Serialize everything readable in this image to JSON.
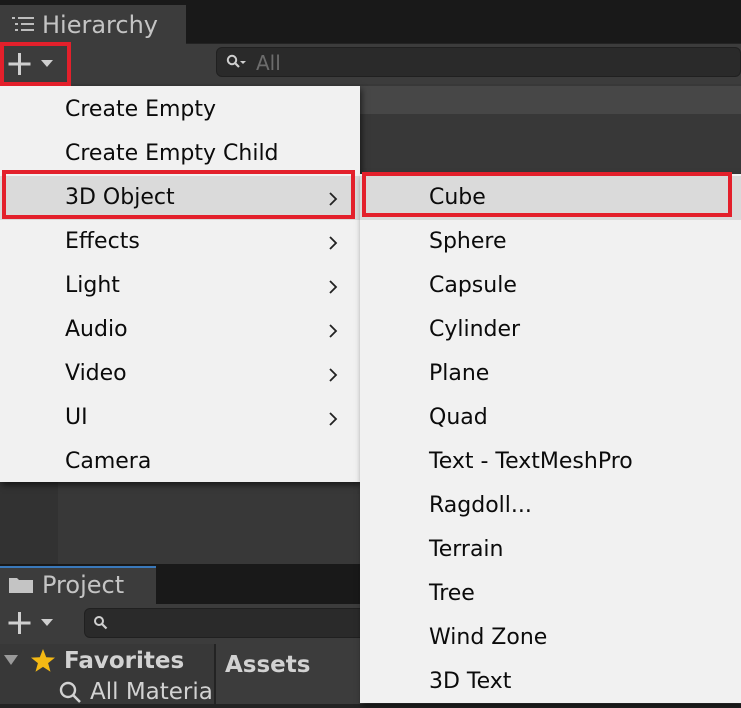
{
  "hierarchy": {
    "tab_title": "Hierarchy",
    "search_placeholder": "All"
  },
  "create_menu": {
    "items": [
      {
        "label": "Create Empty",
        "has_submenu": false
      },
      {
        "label": "Create Empty Child",
        "has_submenu": false
      },
      {
        "label": "3D Object",
        "has_submenu": true
      },
      {
        "label": "Effects",
        "has_submenu": true
      },
      {
        "label": "Light",
        "has_submenu": true
      },
      {
        "label": "Audio",
        "has_submenu": true
      },
      {
        "label": "Video",
        "has_submenu": true
      },
      {
        "label": "UI",
        "has_submenu": true
      },
      {
        "label": "Camera",
        "has_submenu": false
      }
    ]
  },
  "submenu_3d_object": {
    "items": [
      {
        "label": "Cube"
      },
      {
        "label": "Sphere"
      },
      {
        "label": "Capsule"
      },
      {
        "label": "Cylinder"
      },
      {
        "label": "Plane"
      },
      {
        "label": "Quad"
      },
      {
        "label": "Text - TextMeshPro"
      },
      {
        "label": "Ragdoll..."
      },
      {
        "label": "Terrain"
      },
      {
        "label": "Tree"
      },
      {
        "label": "Wind Zone"
      },
      {
        "label": "3D Text"
      }
    ]
  },
  "project": {
    "tab_title": "Project",
    "favorites_label": "Favorites",
    "all_materials_label": "All Materia",
    "assets_label": "Assets"
  },
  "highlight_color": "#e3202b",
  "icons": [
    "hierarchy-list-icon",
    "plus-icon",
    "dropdown-arrow-icon",
    "search-icon",
    "chevron-right-icon",
    "folder-icon",
    "star-icon",
    "foldout-arrow-icon"
  ]
}
